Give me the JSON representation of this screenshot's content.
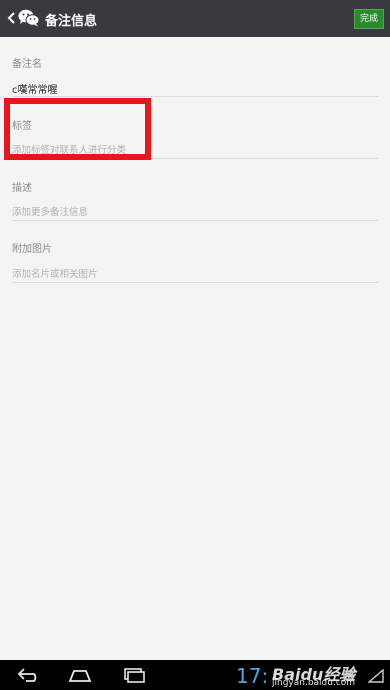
{
  "header": {
    "title": "备注信息",
    "done_label": "完成"
  },
  "form": {
    "remark_name": {
      "label": "备注名",
      "value": "c嘆常常喔"
    },
    "tags": {
      "label": "标签",
      "placeholder": "添加标签对联系人进行分类"
    },
    "description": {
      "label": "描述",
      "placeholder": "添加更多备注信息"
    },
    "attach_image": {
      "label": "附加图片",
      "placeholder": "添加名片或相关图片"
    }
  },
  "status_bar": {
    "clock": "17:",
    "watermark": "Baidu经验",
    "watermark_url": "jingyan.baidu.com"
  },
  "colors": {
    "topbar": "#393a3f",
    "done_button": "#2a8a2c",
    "highlight": "#e8151b"
  },
  "icons": {
    "back": "chevron-left-icon",
    "app": "wechat-icon",
    "nav_back": "back-arrow-icon",
    "nav_home": "home-icon",
    "nav_recent": "recent-apps-icon"
  }
}
